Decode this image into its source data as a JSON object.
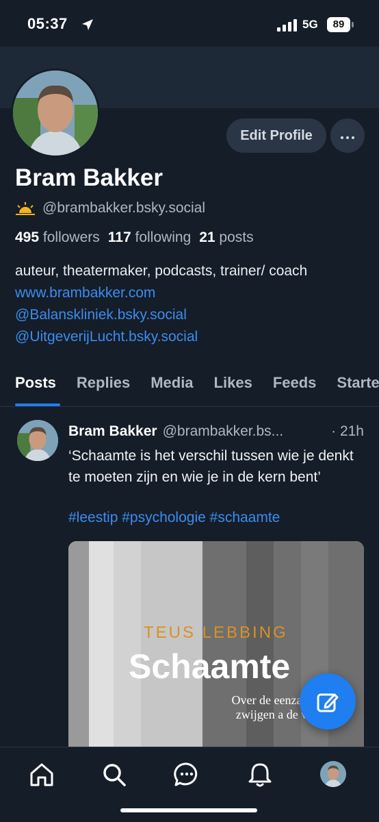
{
  "status_bar": {
    "time": "05:37",
    "network": "5G",
    "battery": "89"
  },
  "profile": {
    "name": "Bram Bakker",
    "handle_emoji": "🌅",
    "handle": "@brambakker.bsky.social",
    "edit_label": "Edit Profile",
    "followers_count": "495",
    "followers_label": "followers",
    "following_count": "117",
    "following_label": "following",
    "posts_count": "21",
    "posts_label": "posts",
    "bio_text": "auteur, theatermaker, podcasts, trainer/ coach ",
    "bio_link_1": "www.brambakker.com",
    "bio_link_2": "@Balanskliniek.bsky.social",
    "bio_link_3": "@UitgeverijLucht.bsky.social"
  },
  "tabs": [
    {
      "label": "Posts",
      "active": true
    },
    {
      "label": "Replies"
    },
    {
      "label": "Media"
    },
    {
      "label": "Likes"
    },
    {
      "label": "Feeds"
    },
    {
      "label": "Starter Packs"
    }
  ],
  "post": {
    "name": "Bram Bakker",
    "handle": "@brambakker.bs...",
    "time": "· 21h",
    "text": "‘Schaamte is het verschil tussen wie je denkt te moeten zijn en wie je in de kern bent’",
    "tags": "#leestip #psychologie #schaamte",
    "image": {
      "author": "TEUS LEBBING",
      "title": "Schaamte",
      "subtitle": "Over de eenzaam en het zwijgen a de voordeur"
    }
  },
  "icons": {
    "location": "location-arrow-icon",
    "compose": "pencil-square-icon",
    "home": "home-icon",
    "search": "search-icon",
    "chat": "chat-bubble-icon",
    "bell": "bell-icon",
    "more": "ellipsis-icon"
  },
  "colors": {
    "background": "#151d28",
    "accent": "#1f7ef0",
    "link": "#3b8df0"
  }
}
